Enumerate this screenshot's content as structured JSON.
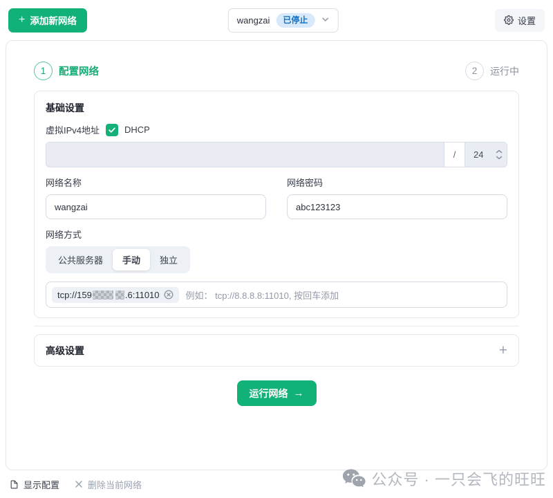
{
  "topbar": {
    "add_network_button": "添加新网络",
    "network_select": {
      "value": "wangzai",
      "status_badge": "已停止"
    },
    "settings_button": "设置"
  },
  "steps": [
    {
      "number": "1",
      "label": "配置网络",
      "state": "active"
    },
    {
      "number": "2",
      "label": "运行中",
      "state": "inactive"
    }
  ],
  "basic_settings": {
    "title": "基础设置",
    "ipv4_label": "虚拟IPv4地址",
    "dhcp_label": "DHCP",
    "dhcp_checked": true,
    "ip_value": "",
    "prefix_separator": "/",
    "prefix_length": "24",
    "network_name_label": "网络名称",
    "network_name_value": "wangzai",
    "network_secret_label": "网络密码",
    "network_secret_value": "abc123123",
    "network_method_label": "网络方式",
    "method_options": {
      "0": "公共服务器",
      "1": "手动",
      "2": "独立"
    },
    "selected_method": "手动",
    "peer_tag": {
      "prefix": "tcp://159",
      "suffix": ".6:11010"
    },
    "peer_hint": "例如： tcp://8.8.8.8:11010, 按回车添加"
  },
  "advanced_settings": {
    "title": "高级设置",
    "expand_icon": "+"
  },
  "run_button": {
    "label": "运行网络",
    "arrow": "→"
  },
  "footer": {
    "show_config": "显示配置",
    "delete_network": "删除当前网络",
    "watermark": "公众号 · 一只会飞的旺旺"
  },
  "colors": {
    "primary_green": "#12b178",
    "badge_bg_blue": "#d7e9fb",
    "badge_text_blue": "#1272c4",
    "disabled_input_bg": "#e9edf3",
    "hint_gray": "#939aa7"
  }
}
